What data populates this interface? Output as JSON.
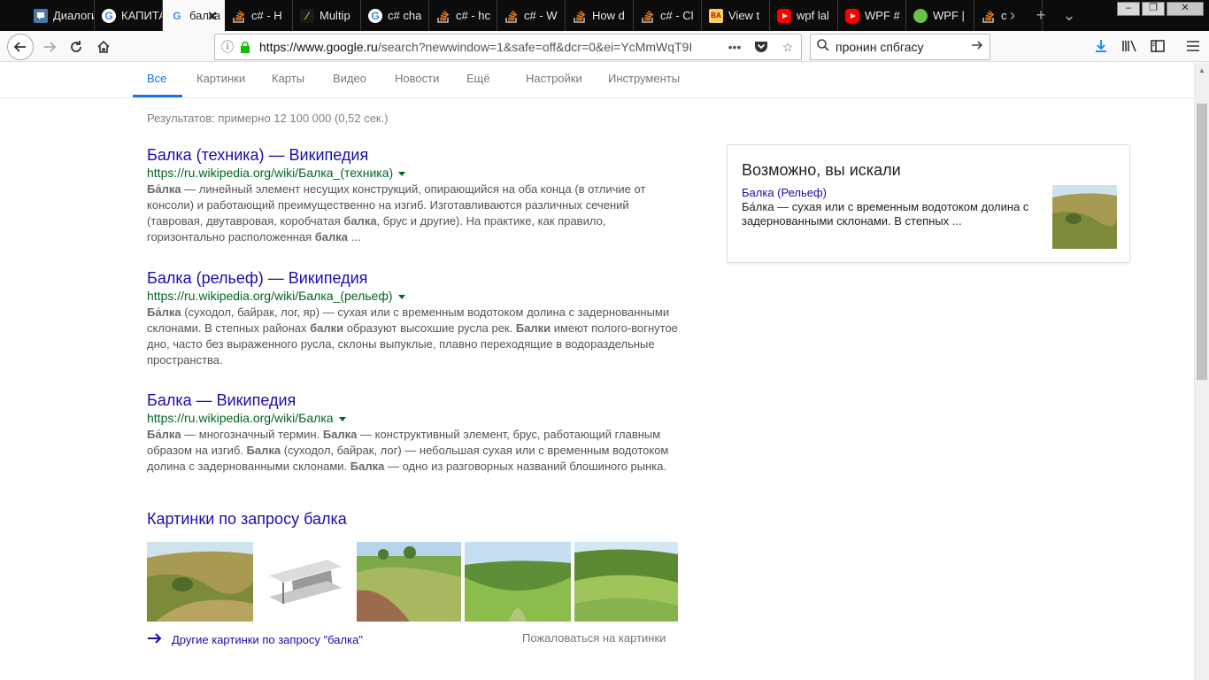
{
  "tabs": [
    {
      "title": "Диалоги",
      "icon": "chat-icon"
    },
    {
      "title": "КАПИТАЛ",
      "icon": "google-icon"
    },
    {
      "title": "балка",
      "icon": "google-icon",
      "active": true
    },
    {
      "title": "c# - H",
      "icon": "stackoverflow-icon"
    },
    {
      "title": "Multip",
      "icon": "multi-icon"
    },
    {
      "title": "c# cha",
      "icon": "google-icon"
    },
    {
      "title": "c# - hc",
      "icon": "stackoverflow-icon"
    },
    {
      "title": "c# - W",
      "icon": "stackoverflow-icon"
    },
    {
      "title": "How d",
      "icon": "stackoverflow-icon"
    },
    {
      "title": "c# - Cl",
      "icon": "stackoverflow-icon"
    },
    {
      "title": "View t",
      "icon": "ba-icon"
    },
    {
      "title": "wpf lal",
      "icon": "youtube-icon"
    },
    {
      "title": "WPF #",
      "icon": "youtube-icon"
    },
    {
      "title": "WPF |",
      "icon": "leaf-icon"
    },
    {
      "title": "c",
      "icon": "stackoverflow-icon"
    }
  ],
  "nav": {
    "url_host": "https://www.google.ru",
    "url_rest": "/search?newwindow=1&safe=off&dcr=0&ei=YcMmWqT9I",
    "search_value": "пронин спбгасу",
    "more_label": "•••"
  },
  "google_tabs": [
    "Все",
    "Картинки",
    "Карты",
    "Видео",
    "Новости",
    "Ещё",
    "Настройки",
    "Инструменты"
  ],
  "stats": "Результатов: примерно 12 100 000 (0,52 сек.)",
  "results": [
    {
      "title": "Балка (техника) — Википедия",
      "url": "https://ru.wikipedia.org/wiki/Балка_(техника)",
      "snippet": [
        {
          "t": "Ба́лка",
          "b": true
        },
        {
          "t": " — линейный элемент несущих конструкций, опирающийся на оба конца (в отличие от консоли) и работающий преимущественно на изгиб. Изготавливаются различных сечений (тавровая, двутавровая, коробчатая "
        },
        {
          "t": "балка",
          "b": true
        },
        {
          "t": ", брус и другие). На практике, как правило, горизонтально расположенная "
        },
        {
          "t": "балка",
          "b": true
        },
        {
          "t": " ..."
        }
      ]
    },
    {
      "title": "Балка (рельеф) — Википедия",
      "url": "https://ru.wikipedia.org/wiki/Балка_(рельеф)",
      "snippet": [
        {
          "t": "Ба́лка",
          "b": true
        },
        {
          "t": " (суходол, байрак, лог, яр) — сухая или с временным водотоком долина с задернованными склонами. В степных районах "
        },
        {
          "t": "балки",
          "b": true
        },
        {
          "t": " образуют высохшие русла рек. "
        },
        {
          "t": "Балки",
          "b": true
        },
        {
          "t": " имеют полого-вогнутое дно, часто без выраженного русла, склоны выпуклые, плавно переходящие в водораздельные пространства."
        }
      ]
    },
    {
      "title": "Балка — Википедия",
      "url": "https://ru.wikipedia.org/wiki/Балка",
      "snippet": [
        {
          "t": "Ба́лка",
          "b": true
        },
        {
          "t": " — многозначный термин. "
        },
        {
          "t": "Балка",
          "b": true
        },
        {
          "t": " — конструктивный элемент, брус, работающий главным образом на изгиб. "
        },
        {
          "t": "Балка",
          "b": true
        },
        {
          "t": " (суходол, байрак, лог) — небольшая сухая или с временным водотоком долина с задернованными склонами. "
        },
        {
          "t": "Балка",
          "b": true
        },
        {
          "t": " — одно из разговорных названий блошиного рынка."
        }
      ]
    }
  ],
  "images": {
    "heading": "Картинки по запросу балка",
    "more_link": "Другие картинки по запросу \"балка\"",
    "report": "Пожаловаться на картинки"
  },
  "panel": {
    "title": "Возможно, вы искали",
    "link": "Балка (Рельеф)",
    "text": "Ба́лка — сухая или с временным водотоком долина с задернованными склонами. В степных ..."
  },
  "colors": {
    "link": "#1a0dab",
    "url_green": "#006621",
    "tab_active": "#1a73e8",
    "tabbar_bg": "#0c0c0d"
  }
}
